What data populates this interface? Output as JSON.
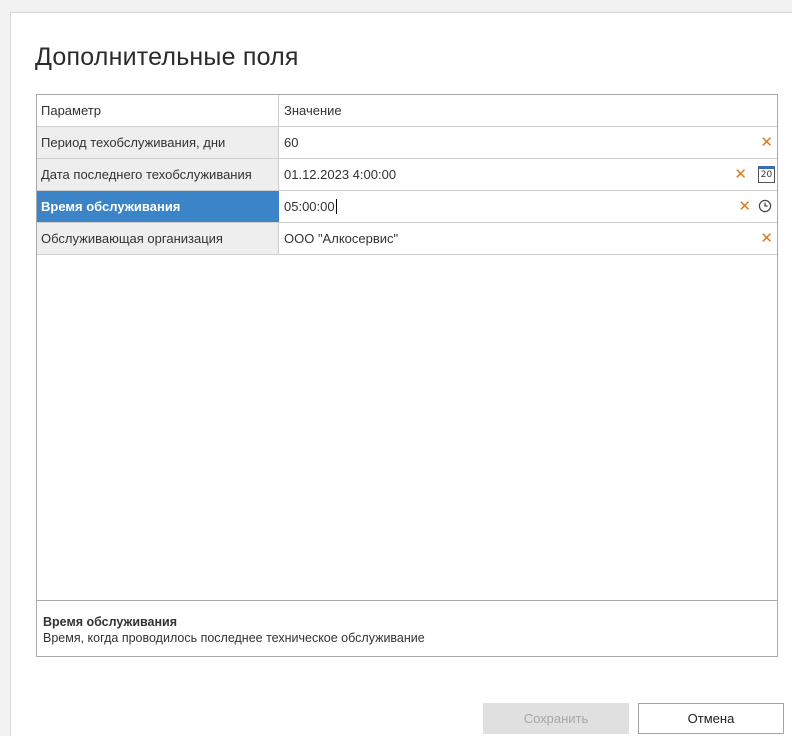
{
  "dialog": {
    "title": "Дополнительные поля"
  },
  "grid": {
    "header": {
      "param": "Параметр",
      "value": "Значение"
    },
    "rows": [
      {
        "label": "Период техобслуживания, дни",
        "value": "60",
        "editor": "text",
        "selected": false
      },
      {
        "label": "Дата последнего техобслуживания",
        "value": "01.12.2023 4:00:00",
        "editor": "date",
        "calendar_day": "20",
        "selected": false
      },
      {
        "label": "Время обслуживания",
        "value": "05:00:00",
        "editor": "time",
        "selected": true
      },
      {
        "label": "Обслуживающая организация",
        "value": "ООО \"Алкосервис\"",
        "editor": "text",
        "selected": false
      }
    ],
    "clear_glyph": "✕"
  },
  "description": {
    "title": "Время обслуживания",
    "text": "Время, когда проводилось последнее техническое обслуживание"
  },
  "buttons": {
    "save_label": "Сохранить",
    "save_enabled": false,
    "cancel_label": "Отмена"
  },
  "colors": {
    "selection": "#3b84c8",
    "clear_icon": "#e07b1a"
  }
}
